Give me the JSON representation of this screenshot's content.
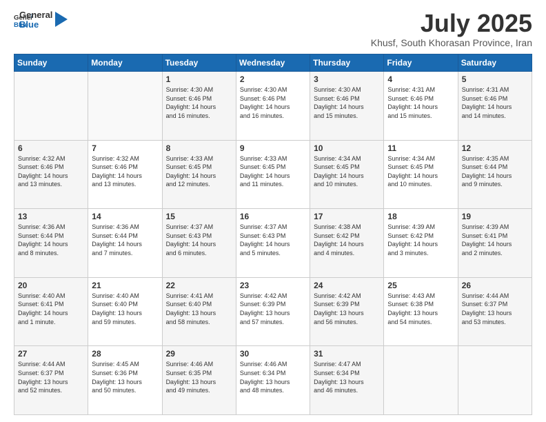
{
  "logo": {
    "line1": "General",
    "line2": "Blue"
  },
  "title": "July 2025",
  "location": "Khusf, South Khorasan Province, Iran",
  "headers": [
    "Sunday",
    "Monday",
    "Tuesday",
    "Wednesday",
    "Thursday",
    "Friday",
    "Saturday"
  ],
  "weeks": [
    [
      {
        "day": "",
        "info": ""
      },
      {
        "day": "",
        "info": ""
      },
      {
        "day": "1",
        "info": "Sunrise: 4:30 AM\nSunset: 6:46 PM\nDaylight: 14 hours\nand 16 minutes."
      },
      {
        "day": "2",
        "info": "Sunrise: 4:30 AM\nSunset: 6:46 PM\nDaylight: 14 hours\nand 16 minutes."
      },
      {
        "day": "3",
        "info": "Sunrise: 4:30 AM\nSunset: 6:46 PM\nDaylight: 14 hours\nand 15 minutes."
      },
      {
        "day": "4",
        "info": "Sunrise: 4:31 AM\nSunset: 6:46 PM\nDaylight: 14 hours\nand 15 minutes."
      },
      {
        "day": "5",
        "info": "Sunrise: 4:31 AM\nSunset: 6:46 PM\nDaylight: 14 hours\nand 14 minutes."
      }
    ],
    [
      {
        "day": "6",
        "info": "Sunrise: 4:32 AM\nSunset: 6:46 PM\nDaylight: 14 hours\nand 13 minutes."
      },
      {
        "day": "7",
        "info": "Sunrise: 4:32 AM\nSunset: 6:46 PM\nDaylight: 14 hours\nand 13 minutes."
      },
      {
        "day": "8",
        "info": "Sunrise: 4:33 AM\nSunset: 6:45 PM\nDaylight: 14 hours\nand 12 minutes."
      },
      {
        "day": "9",
        "info": "Sunrise: 4:33 AM\nSunset: 6:45 PM\nDaylight: 14 hours\nand 11 minutes."
      },
      {
        "day": "10",
        "info": "Sunrise: 4:34 AM\nSunset: 6:45 PM\nDaylight: 14 hours\nand 10 minutes."
      },
      {
        "day": "11",
        "info": "Sunrise: 4:34 AM\nSunset: 6:45 PM\nDaylight: 14 hours\nand 10 minutes."
      },
      {
        "day": "12",
        "info": "Sunrise: 4:35 AM\nSunset: 6:44 PM\nDaylight: 14 hours\nand 9 minutes."
      }
    ],
    [
      {
        "day": "13",
        "info": "Sunrise: 4:36 AM\nSunset: 6:44 PM\nDaylight: 14 hours\nand 8 minutes."
      },
      {
        "day": "14",
        "info": "Sunrise: 4:36 AM\nSunset: 6:44 PM\nDaylight: 14 hours\nand 7 minutes."
      },
      {
        "day": "15",
        "info": "Sunrise: 4:37 AM\nSunset: 6:43 PM\nDaylight: 14 hours\nand 6 minutes."
      },
      {
        "day": "16",
        "info": "Sunrise: 4:37 AM\nSunset: 6:43 PM\nDaylight: 14 hours\nand 5 minutes."
      },
      {
        "day": "17",
        "info": "Sunrise: 4:38 AM\nSunset: 6:42 PM\nDaylight: 14 hours\nand 4 minutes."
      },
      {
        "day": "18",
        "info": "Sunrise: 4:39 AM\nSunset: 6:42 PM\nDaylight: 14 hours\nand 3 minutes."
      },
      {
        "day": "19",
        "info": "Sunrise: 4:39 AM\nSunset: 6:41 PM\nDaylight: 14 hours\nand 2 minutes."
      }
    ],
    [
      {
        "day": "20",
        "info": "Sunrise: 4:40 AM\nSunset: 6:41 PM\nDaylight: 14 hours\nand 1 minute."
      },
      {
        "day": "21",
        "info": "Sunrise: 4:40 AM\nSunset: 6:40 PM\nDaylight: 13 hours\nand 59 minutes."
      },
      {
        "day": "22",
        "info": "Sunrise: 4:41 AM\nSunset: 6:40 PM\nDaylight: 13 hours\nand 58 minutes."
      },
      {
        "day": "23",
        "info": "Sunrise: 4:42 AM\nSunset: 6:39 PM\nDaylight: 13 hours\nand 57 minutes."
      },
      {
        "day": "24",
        "info": "Sunrise: 4:42 AM\nSunset: 6:39 PM\nDaylight: 13 hours\nand 56 minutes."
      },
      {
        "day": "25",
        "info": "Sunrise: 4:43 AM\nSunset: 6:38 PM\nDaylight: 13 hours\nand 54 minutes."
      },
      {
        "day": "26",
        "info": "Sunrise: 4:44 AM\nSunset: 6:37 PM\nDaylight: 13 hours\nand 53 minutes."
      }
    ],
    [
      {
        "day": "27",
        "info": "Sunrise: 4:44 AM\nSunset: 6:37 PM\nDaylight: 13 hours\nand 52 minutes."
      },
      {
        "day": "28",
        "info": "Sunrise: 4:45 AM\nSunset: 6:36 PM\nDaylight: 13 hours\nand 50 minutes."
      },
      {
        "day": "29",
        "info": "Sunrise: 4:46 AM\nSunset: 6:35 PM\nDaylight: 13 hours\nand 49 minutes."
      },
      {
        "day": "30",
        "info": "Sunrise: 4:46 AM\nSunset: 6:34 PM\nDaylight: 13 hours\nand 48 minutes."
      },
      {
        "day": "31",
        "info": "Sunrise: 4:47 AM\nSunset: 6:34 PM\nDaylight: 13 hours\nand 46 minutes."
      },
      {
        "day": "",
        "info": ""
      },
      {
        "day": "",
        "info": ""
      }
    ]
  ]
}
